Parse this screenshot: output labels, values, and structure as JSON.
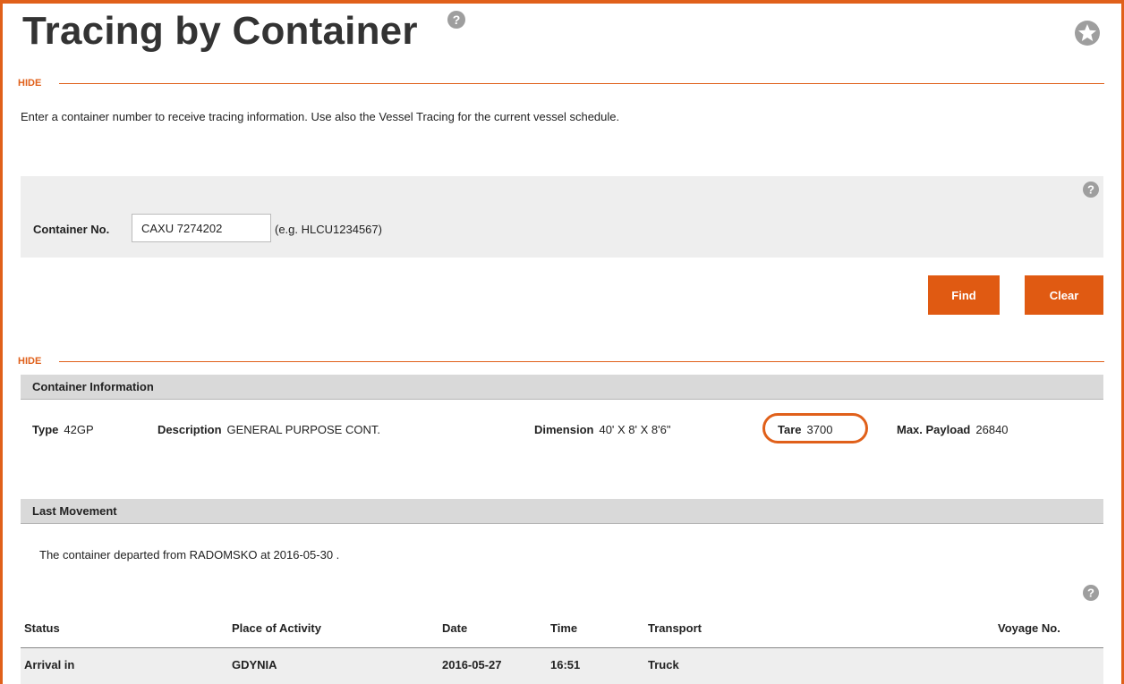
{
  "page": {
    "title": "Tracing by Container",
    "intro": "Enter a container number to receive tracing information. Use also the Vessel Tracing for the current vessel schedule."
  },
  "colors": {
    "accent": "#e0601a",
    "button": "#e05a12",
    "panel_bg": "#eeeeee",
    "section_bg": "#d9d9d9"
  },
  "search_section": {
    "hide_label": "HIDE",
    "container_label": "Container No.",
    "container_value": "CAXU 7274202",
    "example": "(e.g. HLCU1234567)",
    "find_label": "Find",
    "clear_label": "Clear"
  },
  "results_section": {
    "hide_label": "HIDE"
  },
  "container_info": {
    "header": "Container Information",
    "type_label": "Type",
    "type_value": "42GP",
    "description_label": "Description",
    "description_value": "GENERAL PURPOSE CONT.",
    "dimension_label": "Dimension",
    "dimension_value": "40' X 8' X 8'6\"",
    "tare_label": "Tare",
    "tare_value": "3700",
    "payload_label": "Max. Payload",
    "payload_value": "26840"
  },
  "last_movement": {
    "header": "Last Movement",
    "text": "The container departed from RADOMSKO at 2016-05-30 ."
  },
  "table": {
    "columns": {
      "status": "Status",
      "place": "Place of Activity",
      "date": "Date",
      "time": "Time",
      "transport": "Transport",
      "voyage": "Voyage No."
    },
    "rows": [
      {
        "status": "Arrival in",
        "place": "GDYNIA",
        "date": "2016-05-27",
        "time": "16:51",
        "transport": "Truck",
        "voyage": ""
      }
    ]
  },
  "icons": {
    "help": "help-icon",
    "favorite": "star-icon"
  }
}
